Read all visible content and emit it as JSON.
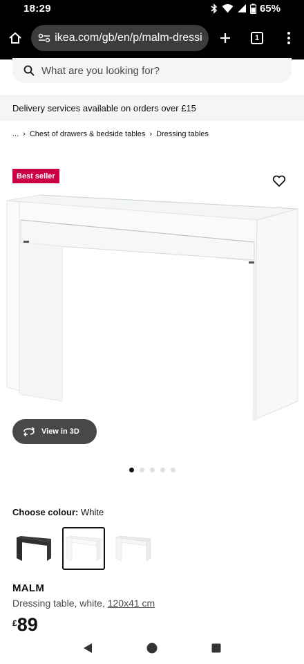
{
  "status_bar": {
    "time": "18:29",
    "battery": "65%"
  },
  "browser": {
    "url": "ikea.com/gb/en/p/malm-dressi",
    "tab_count": "1"
  },
  "search": {
    "placeholder": "What are you looking for?"
  },
  "banner": {
    "text": "Delivery services available on orders over £15"
  },
  "breadcrumb": {
    "ellipsis": "...",
    "items": [
      "Chest of drawers & bedside tables",
      "Dressing tables"
    ]
  },
  "product": {
    "badge": "Best seller",
    "view_3d_label": "View in 3D",
    "image_dots": 5,
    "active_dot": 0,
    "colour_label": "Choose colour:",
    "colour_value": "White",
    "colour_options": [
      "black-brown",
      "white",
      "white-grey"
    ],
    "selected_colour_index": 1,
    "name": "MALM",
    "description": "Dressing table, white, ",
    "size": "120x41 cm",
    "currency": "£",
    "price": "89"
  },
  "colors": {
    "badge": "#cc0044",
    "view3d_bg": "#484848",
    "toolbar_bg": "#000000"
  }
}
